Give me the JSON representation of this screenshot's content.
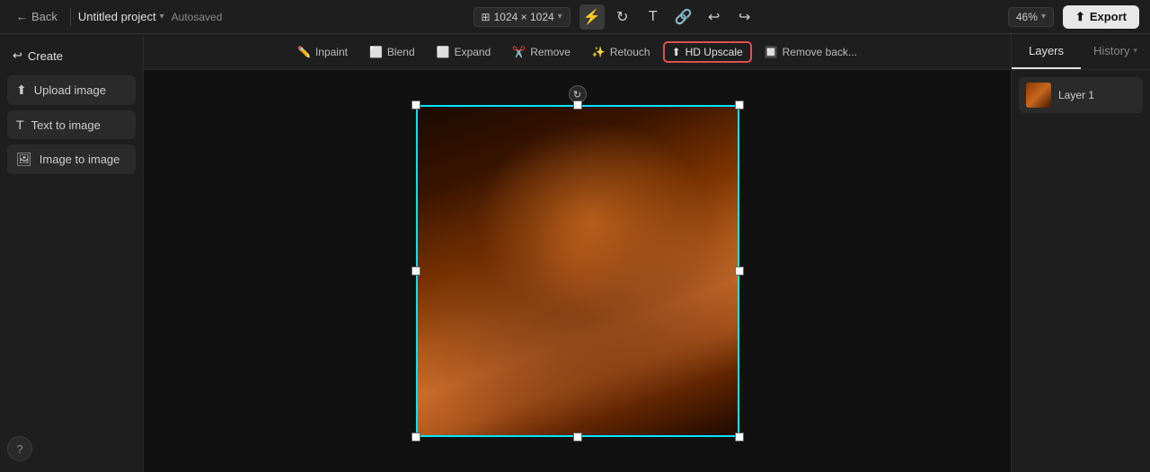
{
  "topbar": {
    "back_label": "Back",
    "project_name": "Untitled project",
    "autosaved": "Autosaved",
    "canvas_size": "1024 × 1024",
    "zoom_level": "46%",
    "export_label": "Export"
  },
  "toolbar_tools": {
    "generate_icon": "⚡",
    "rotate_icon": "↻",
    "text_icon": "T",
    "link_icon": "🔗",
    "undo_icon": "↩",
    "redo_icon": "↪"
  },
  "tools": [
    {
      "id": "inpaint",
      "label": "Inpaint",
      "icon": "✏️",
      "active": false
    },
    {
      "id": "blend",
      "label": "Blend",
      "icon": "⬜",
      "active": false
    },
    {
      "id": "expand",
      "label": "Expand",
      "icon": "⬜",
      "active": false
    },
    {
      "id": "remove",
      "label": "Remove",
      "icon": "✂️",
      "active": false
    },
    {
      "id": "retouch",
      "label": "Retouch",
      "icon": "✨",
      "active": false
    },
    {
      "id": "hd-upscale",
      "label": "HD Upscale",
      "icon": "⬆",
      "active": true
    },
    {
      "id": "remove-back",
      "label": "Remove back...",
      "icon": "🔲",
      "active": false
    }
  ],
  "sidebar": {
    "create_label": "Create",
    "buttons": [
      {
        "id": "upload-image",
        "label": "Upload image",
        "icon": "⬆"
      },
      {
        "id": "text-to-image",
        "label": "Text to image",
        "icon": "T"
      },
      {
        "id": "image-to-image",
        "label": "Image to image",
        "icon": "🖼"
      }
    ]
  },
  "right_panel": {
    "tabs": [
      {
        "id": "layers",
        "label": "Layers",
        "active": true
      },
      {
        "id": "history",
        "label": "History",
        "active": false
      }
    ],
    "layers": [
      {
        "id": "layer1",
        "name": "Layer 1"
      }
    ]
  }
}
